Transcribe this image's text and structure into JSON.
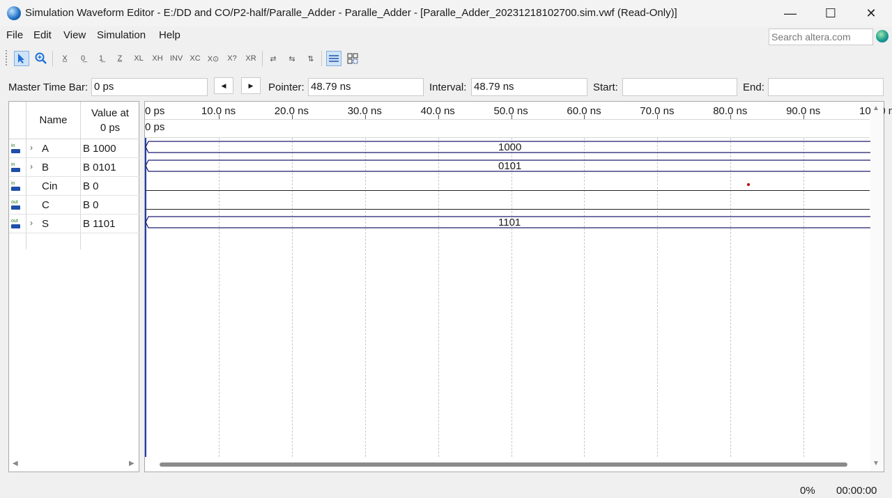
{
  "window": {
    "title": "Simulation Waveform Editor - E:/DD and CO/P2-half/Paralle_Adder - Paralle_Adder - [Paralle_Adder_20231218102700.sim.vwf (Read-Only)]",
    "minimize": "—",
    "maximize": "☐",
    "close": "✕"
  },
  "menu": {
    "items": [
      "File",
      "Edit",
      "View",
      "Simulation",
      "Help"
    ],
    "search_placeholder": "Search altera.com"
  },
  "toolbar": {
    "icons": [
      "pointer-tool-icon",
      "zoom-tool-icon",
      "unknown-value-icon",
      "force-low-icon",
      "force-high-icon",
      "high-impedance-icon",
      "weak-low-icon",
      "weak-high-icon",
      "invert-icon",
      "count-value-icon",
      "clock-icon",
      "arbitrary-value-icon",
      "random-value-icon",
      "snap-to-grid-icon",
      "group-icon",
      "ungroup-icon",
      "sort-icon",
      "grid-view-icon",
      "waveform-view-icon"
    ]
  },
  "timebar": {
    "master_label": "Master Time Bar:",
    "master_value": "0 ps",
    "pointer_label": "Pointer:",
    "pointer_value": "48.79 ns",
    "interval_label": "Interval:",
    "interval_value": "48.79 ns",
    "start_label": "Start:",
    "start_value": "",
    "end_label": "End:",
    "end_value": ""
  },
  "columns": {
    "name": "Name",
    "value_at_line1": "Value at",
    "value_at_line2": "0 ps"
  },
  "signals": [
    {
      "name": "A",
      "value": "B 1000",
      "direction": "in",
      "expandable": true,
      "bus_value": "1000"
    },
    {
      "name": "B",
      "value": "B 0101",
      "direction": "in",
      "expandable": true,
      "bus_value": "0101"
    },
    {
      "name": "Cin",
      "value": "B 0",
      "direction": "in",
      "expandable": false,
      "bus_value": ""
    },
    {
      "name": "C",
      "value": "B 0",
      "direction": "out",
      "expandable": false,
      "bus_value": ""
    },
    {
      "name": "S",
      "value": "B 1101",
      "direction": "out",
      "expandable": true,
      "bus_value": "1101"
    }
  ],
  "timeline": {
    "ticks": [
      "0 ps",
      "10.0 ns",
      "20.0 ns",
      "30.0 ns",
      "40.0 ns",
      "50.0 ns",
      "60.0 ns",
      "70.0 ns",
      "80.0 ns",
      "90.0 ns",
      "100.0 n"
    ],
    "master_marker_label": "0 ps"
  },
  "status": {
    "progress": "0%",
    "elapsed": "00:00:00"
  },
  "colors": {
    "bus_outline": "#1c1c6e",
    "master_marker": "#1f3fae",
    "pointer_dot": "#c00000",
    "selection": "#cfe3f7"
  }
}
